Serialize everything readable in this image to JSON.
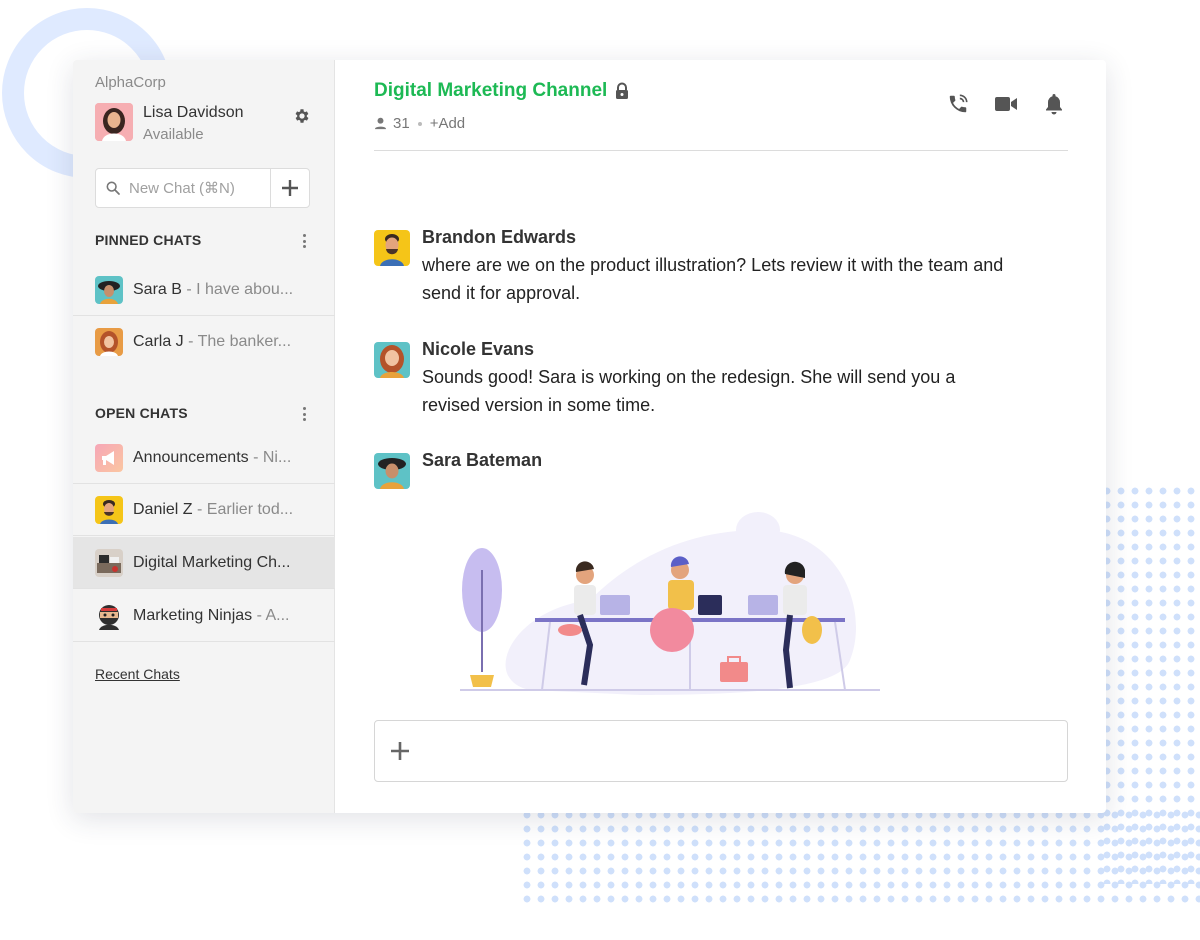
{
  "colors": {
    "accent": "#1db954",
    "sidebar_bg": "#f4f4f4",
    "active_item": "#e5e5e5",
    "deco": "#dfeaff"
  },
  "sidebar": {
    "org_name": "AlphaCorp",
    "user": {
      "name": "Lisa Davidson",
      "status": "Available"
    },
    "search": {
      "placeholder": "New Chat (⌘N)"
    },
    "pinned": {
      "title": "PINNED CHATS",
      "items": [
        {
          "name": "Sara B",
          "preview": " - I have abou..."
        },
        {
          "name": "Carla J",
          "preview": " - The banker..."
        }
      ]
    },
    "open": {
      "title": "OPEN CHATS",
      "items": [
        {
          "name": "Announcements",
          "preview": " - Ni..."
        },
        {
          "name": "Daniel Z",
          "preview": " - Earlier tod..."
        },
        {
          "name": "Digital Marketing Ch...",
          "preview": ""
        },
        {
          "name": "Marketing Ninjas",
          "preview": " - A..."
        }
      ]
    },
    "recent_link": "Recent Chats"
  },
  "channel": {
    "title": "Digital Marketing Channel",
    "member_count": "31",
    "add_label": "+Add",
    "icons": [
      "phone-icon",
      "video-icon",
      "bell-icon"
    ]
  },
  "messages": [
    {
      "author": "Brandon Edwards",
      "text": "where are we on the product illustration? Lets review it with the team and send it for approval."
    },
    {
      "author": "Nicole Evans",
      "text": "Sounds good! Sara is working on the redesign. She will send you a revised version in some time."
    },
    {
      "author": "Sara Bateman",
      "text": ""
    }
  ],
  "composer": {
    "placeholder": ""
  }
}
